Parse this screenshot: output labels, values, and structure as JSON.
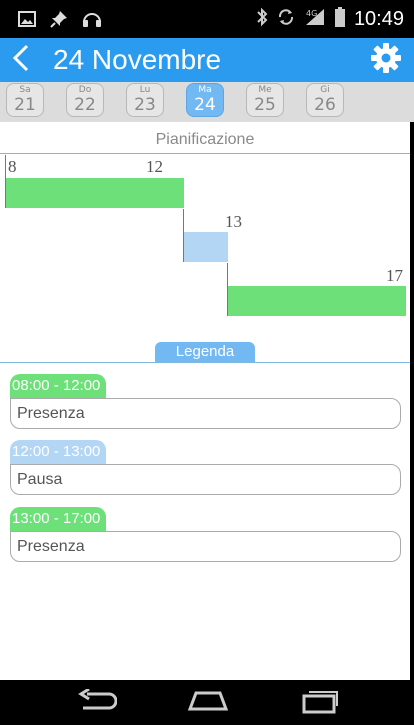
{
  "status_bar": {
    "time": "10:49",
    "left_icons": [
      "image-icon",
      "pin-icon",
      "headphones-icon"
    ],
    "right_icons": [
      "bluetooth-icon",
      "sync-icon",
      "signal-4g-icon",
      "battery-icon"
    ]
  },
  "header": {
    "title": "24 Novembre",
    "accent": "#2b9bef"
  },
  "days": [
    {
      "dow": "Sa",
      "num": "21",
      "selected": false
    },
    {
      "dow": "Do",
      "num": "22",
      "selected": false
    },
    {
      "dow": "Lu",
      "num": "23",
      "selected": false
    },
    {
      "dow": "Ma",
      "num": "24",
      "selected": true
    },
    {
      "dow": "Me",
      "num": "25",
      "selected": false
    },
    {
      "dow": "Gi",
      "num": "26",
      "selected": false
    }
  ],
  "planning": {
    "title": "Pianificazione",
    "tick_labels": [
      "8",
      "12",
      "13",
      "17"
    ],
    "segments": [
      {
        "start": 8,
        "end": 12,
        "color": "#6de07a"
      },
      {
        "start": 12,
        "end": 13,
        "color": "#b3d6f5"
      },
      {
        "start": 13,
        "end": 17,
        "color": "#6de07a"
      }
    ]
  },
  "legend": {
    "title": "Legenda",
    "entries": [
      {
        "time": "08:00 - 12:00",
        "label": "Presenza",
        "color": "#6de07a"
      },
      {
        "time": "12:00 - 13:00",
        "label": "Pausa",
        "color": "#b3d6f5"
      },
      {
        "time": "13:00 - 17:00",
        "label": "Presenza",
        "color": "#6de07a"
      }
    ]
  },
  "navbar": {
    "buttons": [
      "back-nav-icon",
      "home-icon",
      "recents-icon"
    ]
  }
}
